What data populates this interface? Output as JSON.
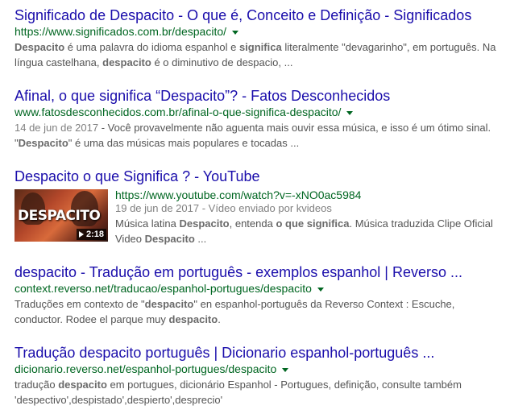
{
  "results": [
    {
      "title": "Significado de Despacito - O que é, Conceito e Definição - Significados",
      "url": "https://www.significados.com.br/despacito/",
      "snippet_parts": [
        {
          "b": true,
          "t": "Despacito"
        },
        {
          "b": false,
          "t": " é uma palavra do idioma espanhol e "
        },
        {
          "b": true,
          "t": "significa"
        },
        {
          "b": false,
          "t": " literalmente \"devagarinho\", em português. Na língua castelhana, "
        },
        {
          "b": true,
          "t": "despacito"
        },
        {
          "b": false,
          "t": " é o diminutivo de despacio, ..."
        }
      ]
    },
    {
      "title": "Afinal, o que significa “Despacito”? - Fatos Desconhecidos",
      "url": "www.fatosdesconhecidos.com.br/afinal-o-que-significa-despacito/",
      "date": "14 de jun de 2017",
      "snippet_parts": [
        {
          "b": false,
          "t": " - Você provavelmente não aguenta mais ouvir essa música, e isso é um ótimo sinal. \""
        },
        {
          "b": true,
          "t": "Despacito"
        },
        {
          "b": false,
          "t": "\" é uma das músicas mais populares e tocadas ..."
        }
      ]
    },
    {
      "title": "Despacito o que Significa ? - YouTube",
      "url": "https://www.youtube.com/watch?v=-xNO0ac5984",
      "meta": "19 de jun de 2017 - Vídeo enviado por kvideos",
      "thumb_text": "DESPACITO",
      "duration": "2:18",
      "snippet_parts": [
        {
          "b": false,
          "t": "Música latina "
        },
        {
          "b": true,
          "t": "Despacito"
        },
        {
          "b": false,
          "t": ", entenda "
        },
        {
          "b": true,
          "t": "o que significa"
        },
        {
          "b": false,
          "t": ". Música traduzida Clipe Oficial Video "
        },
        {
          "b": true,
          "t": "Despacito"
        },
        {
          "b": false,
          "t": " ..."
        }
      ]
    },
    {
      "title": "despacito - Tradução em português - exemplos espanhol | Reverso ...",
      "url": "context.reverso.net/traducao/espanhol-portugues/despacito",
      "snippet_parts": [
        {
          "b": false,
          "t": "Traduções em contexto de \""
        },
        {
          "b": true,
          "t": "despacito"
        },
        {
          "b": false,
          "t": "\" en espanhol-português da Reverso Context : Escuche, conductor. Rodee el parque muy "
        },
        {
          "b": true,
          "t": "despacito"
        },
        {
          "b": false,
          "t": "."
        }
      ]
    },
    {
      "title": "Tradução despacito português | Dicionario espanhol-português ...",
      "url": "dicionario.reverso.net/espanhol-portugues/despacito",
      "snippet_parts": [
        {
          "b": false,
          "t": "tradução "
        },
        {
          "b": true,
          "t": "despacito"
        },
        {
          "b": false,
          "t": " em portugues, dicionário Espanhol - Portugues, definição, consulte também 'despectivo',despistado',despierto',desprecio'"
        }
      ]
    }
  ]
}
